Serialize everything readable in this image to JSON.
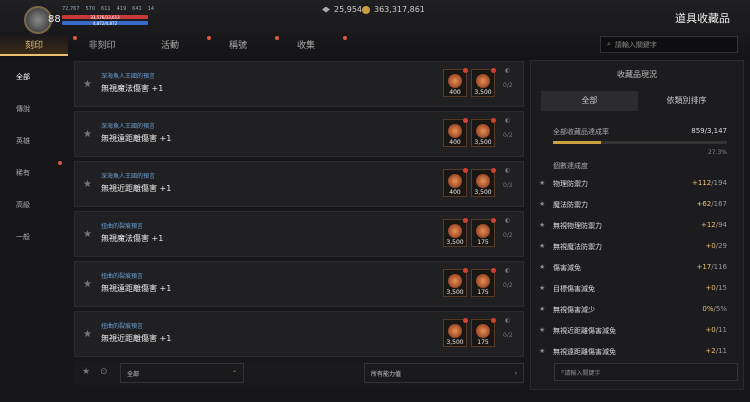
{
  "header": {
    "level": "88",
    "stats": [
      "72,767",
      "570",
      "611",
      "419",
      "641",
      "14"
    ],
    "hp": "33,576/33,613",
    "mp": "4,872/4,872",
    "currency": [
      "25,954",
      "363,317,861"
    ],
    "page_title": "道具收藏品"
  },
  "tabs": [
    "刻印",
    "非刻印",
    "活動",
    "稱號",
    "收集"
  ],
  "search_placeholder": "請輸入關鍵字",
  "sidebar": [
    "全部",
    "傳說",
    "英雄",
    "稀有",
    "高級",
    "一般"
  ],
  "cards": [
    {
      "sub": "深海魚人王國的預言",
      "name": "無視魔法傷害 +1",
      "mats": [
        "400",
        "3,500"
      ],
      "count": "0/2"
    },
    {
      "sub": "深海魚人王國的預言",
      "name": "無視遠距離傷害 +1",
      "mats": [
        "400",
        "3,500"
      ],
      "count": "0/2"
    },
    {
      "sub": "深海魚人王國的預言",
      "name": "無視近距離傷害 +1",
      "mats": [
        "400",
        "3,500"
      ],
      "count": "0/2"
    },
    {
      "sub": "扭曲的裂痕預言",
      "name": "無視魔法傷害 +1",
      "mats": [
        "3,500",
        "175"
      ],
      "count": "0/2"
    },
    {
      "sub": "扭曲的裂痕預言",
      "name": "無視遠距離傷害 +1",
      "mats": [
        "3,500",
        "175"
      ],
      "count": "0/2"
    },
    {
      "sub": "扭曲的裂痕預言",
      "name": "無視近距離傷害 +1",
      "mats": [
        "3,500",
        "175"
      ],
      "count": "0/2"
    }
  ],
  "bottom": {
    "filter": "全部",
    "ability": "所有能力值",
    "search_placeholder": "請輸入關鍵字"
  },
  "right": {
    "title": "收藏品現況",
    "tabs": [
      "全部",
      "依類別排序"
    ],
    "total_label": "全部收藏品達成率",
    "total_value": "859/3,147",
    "percent": "27.3%",
    "progress": 0.273,
    "section": "個數達成度",
    "rows": [
      {
        "name": "物理防禦力",
        "val": "+112",
        "max": "/194"
      },
      {
        "name": "魔法防禦力",
        "val": "+62",
        "max": "/167"
      },
      {
        "name": "無視物理防禦力",
        "val": "+12",
        "max": "/94"
      },
      {
        "name": "無視魔法防禦力",
        "val": "+0",
        "max": "/29"
      },
      {
        "name": "傷害減免",
        "val": "+17",
        "max": "/116"
      },
      {
        "name": "目標傷害減免",
        "val": "+0",
        "max": "/15"
      },
      {
        "name": "無視傷害減少",
        "val": "0%",
        "max": "/5%"
      },
      {
        "name": "無視近距離傷害減免",
        "val": "+0",
        "max": "/11"
      },
      {
        "name": "無視遠距離傷害減免",
        "val": "+2",
        "max": "/11"
      }
    ]
  }
}
